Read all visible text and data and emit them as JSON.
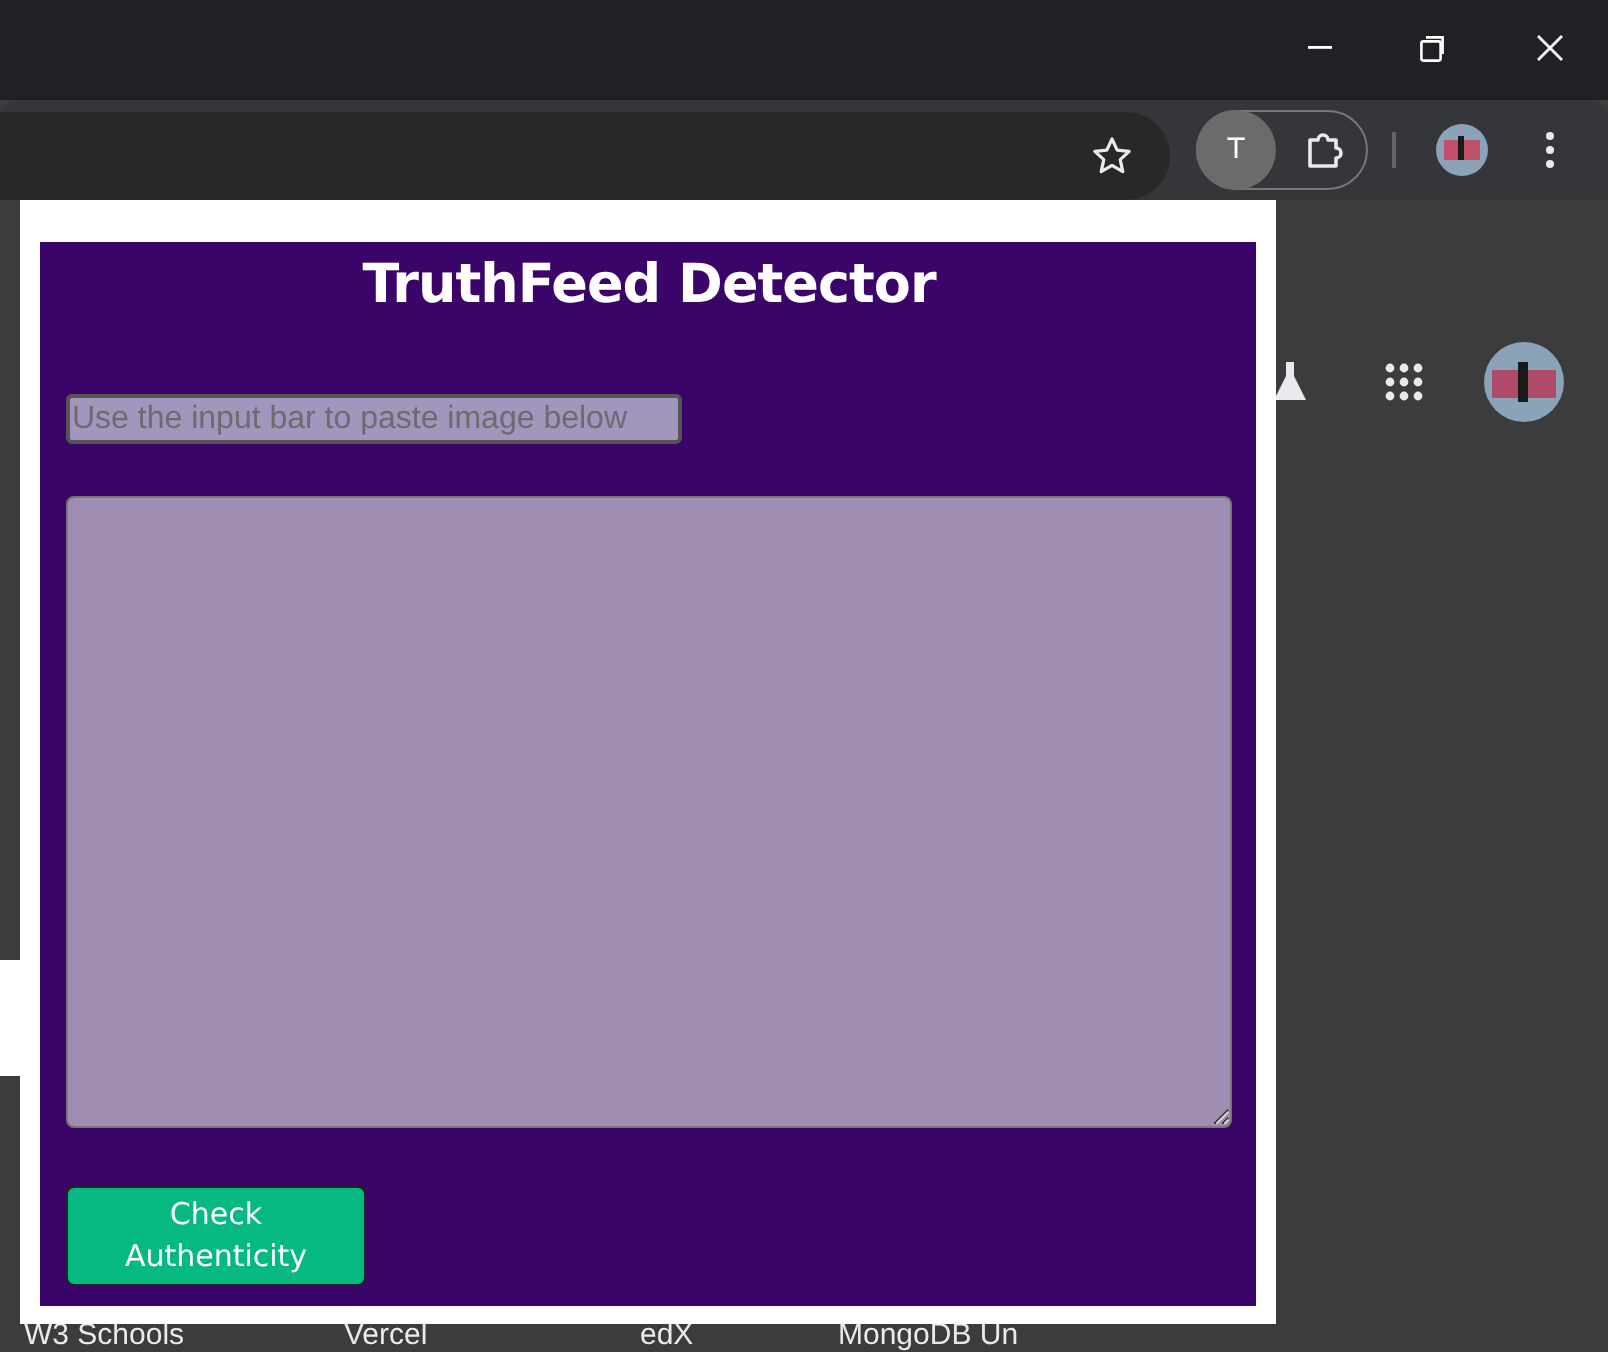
{
  "extension": {
    "letter": "T"
  },
  "popup": {
    "title": "TruthFeed Detector",
    "input": {
      "placeholder": "Use the input bar to paste image below"
    },
    "button": "Check Authenticity"
  },
  "bookmarks": [
    "W3 Schools",
    "Vercel",
    "edX",
    "MongoDB Un"
  ]
}
